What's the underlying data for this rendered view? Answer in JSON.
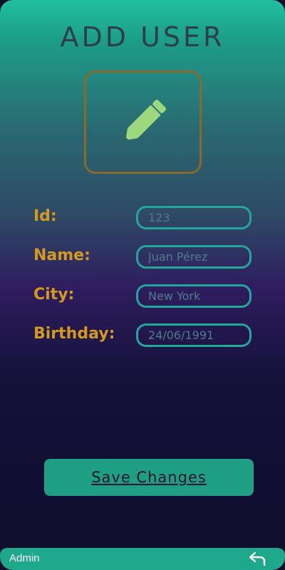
{
  "header": {
    "title": "ADD USER"
  },
  "avatar": {
    "icon": "pencil-icon",
    "icon_color": "#9dd97c",
    "border_color": "#8a6a2c"
  },
  "form": {
    "fields": [
      {
        "key": "id",
        "label": "Id:",
        "value": "123"
      },
      {
        "key": "name",
        "label": "Name:",
        "value": "Juan Pérez"
      },
      {
        "key": "city",
        "label": "City:",
        "value": "New York"
      },
      {
        "key": "birthday",
        "label": "Birthday:",
        "value": "24/06/1991"
      }
    ]
  },
  "actions": {
    "save_label": "Save Changes"
  },
  "footer": {
    "user_label": "Admin",
    "back_icon": "undo-arrow-icon"
  },
  "colors": {
    "accent": "#1fa98c",
    "label": "#d39a1e",
    "input_border": "#22a89a",
    "title": "#2f3f48"
  }
}
